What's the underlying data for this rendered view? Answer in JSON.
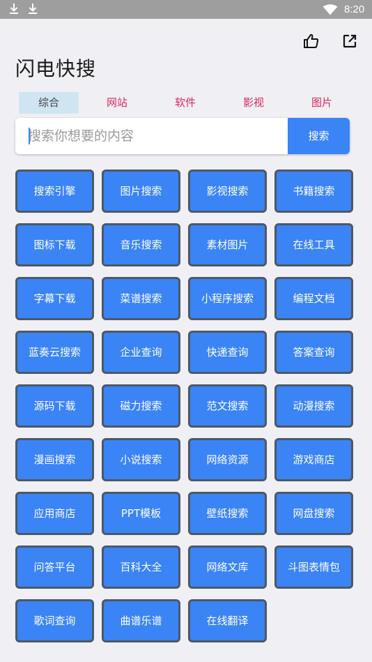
{
  "status_bar": {
    "time": "8:20",
    "icons": [
      "download-icon",
      "download-icon",
      "wifi-icon"
    ]
  },
  "toolbar": {
    "icons": [
      "thumb-up-icon",
      "open-external-icon"
    ]
  },
  "app": {
    "title": "闪电快搜"
  },
  "tabs": [
    {
      "label": "综合",
      "active": true
    },
    {
      "label": "网站",
      "active": false
    },
    {
      "label": "软件",
      "active": false
    },
    {
      "label": "影视",
      "active": false
    },
    {
      "label": "图片",
      "active": false
    }
  ],
  "search": {
    "placeholder": "搜索你想要的内容",
    "value": "",
    "button_label": "搜索"
  },
  "categories": [
    "搜索引擎",
    "图片搜索",
    "影视搜索",
    "书籍搜索",
    "图标下载",
    "音乐搜索",
    "素材图片",
    "在线工具",
    "字幕下载",
    "菜谱搜索",
    "小程序搜索",
    "编程文档",
    "蓝奏云搜索",
    "企业查询",
    "快递查询",
    "答案查询",
    "源码下载",
    "磁力搜索",
    "范文搜索",
    "动漫搜索",
    "漫画搜索",
    "小说搜索",
    "网络资源",
    "游戏商店",
    "应用商店",
    "PPT模板",
    "壁纸搜索",
    "网盘搜索",
    "问答平台",
    "百科大全",
    "网络文库",
    "斗图表情包",
    "歌词查询",
    "曲谱乐谱",
    "在线翻译"
  ],
  "colors": {
    "status_bar": "#9e9e9e",
    "accent": "#3a84f5",
    "tab_text": "#e0245e",
    "tab_active_bg": "#cfe6f2",
    "button_border": "#4d5866",
    "background": "#f0f0f4"
  }
}
